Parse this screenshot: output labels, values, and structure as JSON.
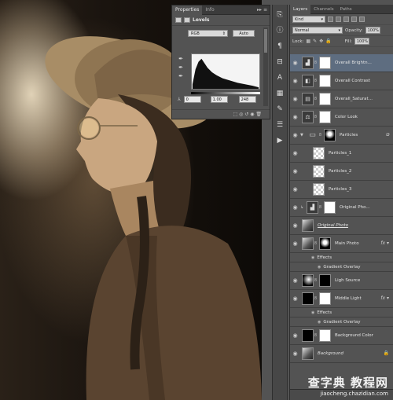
{
  "properties_panel": {
    "tabs": [
      "Properties",
      "Info"
    ],
    "tab_icons": "▸▸ ≡",
    "adjustment_title": "Levels",
    "preset": "RGB",
    "auto_label": "Auto",
    "input_black": "0",
    "input_gamma": "1.00",
    "input_white": "248",
    "footer_icons": "⬚ ◎ ↺ ◉ 🗑"
  },
  "layers_panel": {
    "tabs": [
      "Layers",
      "Channels",
      "Paths"
    ],
    "filter_kind": "Kind",
    "blend_mode": "Normal",
    "opacity_label": "Opacity:",
    "opacity_value": "100%",
    "lock_label": "Lock:",
    "fill_label": "Fill:",
    "fill_value": "100%",
    "layers": [
      {
        "name": "Overall Brightn...",
        "selected": true
      },
      {
        "name": "Overall Contrast"
      },
      {
        "name": "Overall_Saturat..."
      },
      {
        "name": "Color Look"
      },
      {
        "name": "Particles"
      },
      {
        "name": "Particles_1"
      },
      {
        "name": "Particles_2"
      },
      {
        "name": "Particles_3"
      },
      {
        "name": "Original Pho..."
      },
      {
        "name": "Original Photo"
      },
      {
        "name": "Main Photo"
      },
      {
        "name": "Effects"
      },
      {
        "name": "Gradient Overlay"
      },
      {
        "name": "Ligh Source"
      },
      {
        "name": "Middle Light"
      },
      {
        "name": "Effects"
      },
      {
        "name": "Gradient Overlay"
      },
      {
        "name": "Background Color"
      },
      {
        "name": "Background"
      }
    ]
  },
  "watermark": {
    "main": "查字典 教程网",
    "url": "jiaocheng.chazidian.com"
  }
}
